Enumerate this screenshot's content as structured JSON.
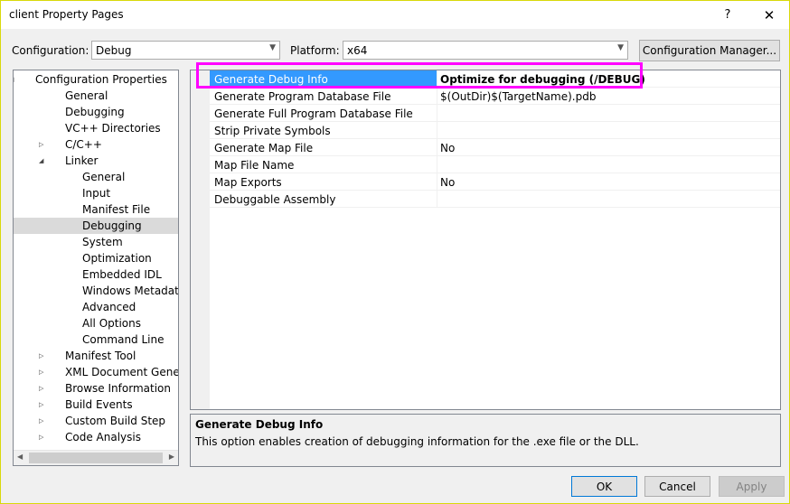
{
  "window": {
    "title": "client Property Pages",
    "help_label": "?",
    "close_label": "✕"
  },
  "config": {
    "configuration_label": "Configuration:",
    "configuration_value": "Debug",
    "platform_label": "Platform:",
    "platform_value": "x64",
    "manager_button": "Configuration Manager..."
  },
  "tree": {
    "items": [
      {
        "label": "Configuration Properties",
        "level": 0,
        "expander": "collapse"
      },
      {
        "label": "General",
        "level": 1
      },
      {
        "label": "Debugging",
        "level": 1
      },
      {
        "label": "VC++ Directories",
        "level": 1
      },
      {
        "label": "C/C++",
        "level": 1,
        "expander": "expand"
      },
      {
        "label": "Linker",
        "level": 1,
        "expander": "collapse"
      },
      {
        "label": "General",
        "level": 2
      },
      {
        "label": "Input",
        "level": 2
      },
      {
        "label": "Manifest File",
        "level": 2
      },
      {
        "label": "Debugging",
        "level": 2,
        "selected": true
      },
      {
        "label": "System",
        "level": 2
      },
      {
        "label": "Optimization",
        "level": 2
      },
      {
        "label": "Embedded IDL",
        "level": 2
      },
      {
        "label": "Windows Metadata",
        "level": 2
      },
      {
        "label": "Advanced",
        "level": 2
      },
      {
        "label": "All Options",
        "level": 2
      },
      {
        "label": "Command Line",
        "level": 2
      },
      {
        "label": "Manifest Tool",
        "level": 1,
        "expander": "expand"
      },
      {
        "label": "XML Document Generator",
        "level": 1,
        "expander": "expand"
      },
      {
        "label": "Browse Information",
        "level": 1,
        "expander": "expand"
      },
      {
        "label": "Build Events",
        "level": 1,
        "expander": "expand"
      },
      {
        "label": "Custom Build Step",
        "level": 1,
        "expander": "expand"
      },
      {
        "label": "Code Analysis",
        "level": 1,
        "expander": "expand"
      }
    ]
  },
  "properties": [
    {
      "name": "Generate Debug Info",
      "value": "Optimize for debugging (/DEBUG)",
      "selected": true
    },
    {
      "name": "Generate Program Database File",
      "value": "$(OutDir)$(TargetName).pdb"
    },
    {
      "name": "Generate Full Program Database File",
      "value": ""
    },
    {
      "name": "Strip Private Symbols",
      "value": ""
    },
    {
      "name": "Generate Map File",
      "value": "No"
    },
    {
      "name": "Map File Name",
      "value": ""
    },
    {
      "name": "Map Exports",
      "value": "No"
    },
    {
      "name": "Debuggable Assembly",
      "value": ""
    }
  ],
  "description": {
    "title": "Generate Debug Info",
    "text": "This option enables creation of debugging information for the .exe file or the DLL."
  },
  "buttons": {
    "ok": "OK",
    "cancel": "Cancel",
    "apply": "Apply"
  },
  "colors": {
    "selection": "#3399ff",
    "highlight_box": "#ff00ff",
    "tree_selection": "#dadada"
  }
}
